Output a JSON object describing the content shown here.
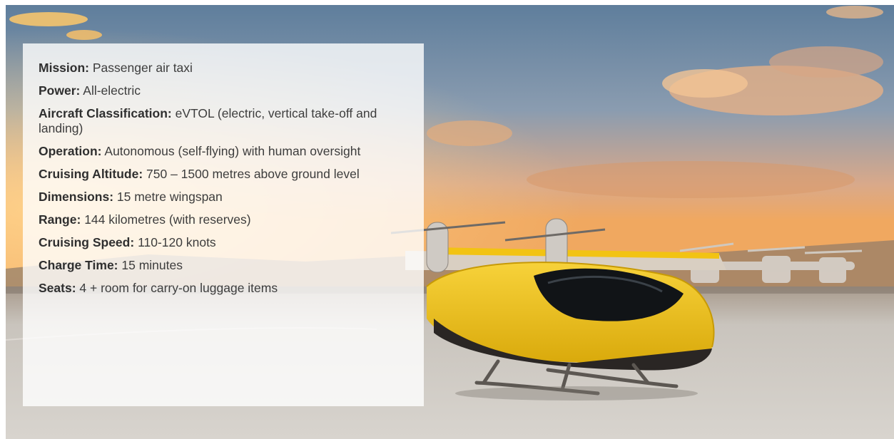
{
  "specs": [
    {
      "label": "Mission:",
      "value": "Passenger air taxi"
    },
    {
      "label": "Power:",
      "value": "All-electric"
    },
    {
      "label": "Aircraft Classification:",
      "value": "eVTOL (electric, vertical take-off and landing)"
    },
    {
      "label": "Operation:",
      "value": "Autonomous (self-flying) with human oversight"
    },
    {
      "label": "Cruising Altitude:",
      "value": "750 – 1500 metres above ground level"
    },
    {
      "label": "Dimensions:",
      "value": "15 metre wingspan"
    },
    {
      "label": "Range:",
      "value": "144 kilometres (with reserves)"
    },
    {
      "label": "Cruising Speed:",
      "value": "110-120 knots"
    },
    {
      "label": "Charge Time:",
      "value": "15 minutes"
    },
    {
      "label": "Seats:",
      "value": "4 + room for carry-on luggage items"
    }
  ],
  "colors": {
    "aircraft_body": "#f2c313",
    "sky_top": "#5f7e9c",
    "sunset_glow": "#f0a860",
    "ground": "#c9c4bd"
  }
}
